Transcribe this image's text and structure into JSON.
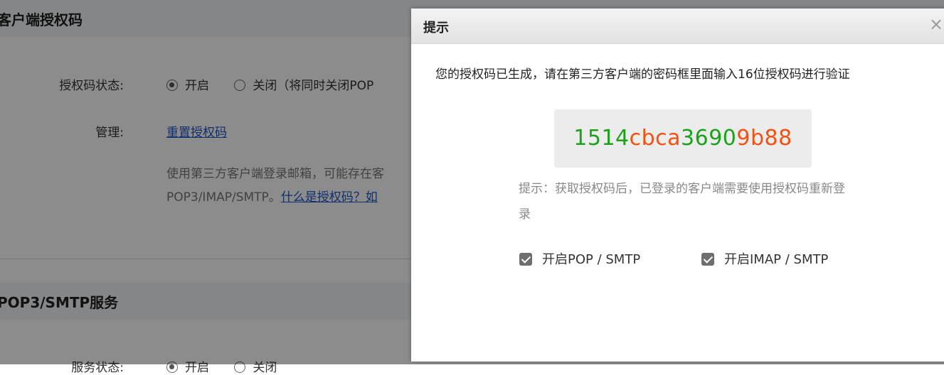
{
  "background": {
    "section1_title": "客户端授权码",
    "status_label": "授权码状态:",
    "status_options": {
      "on": "开启",
      "off": "关闭（将同时关闭POP"
    },
    "manage_label": "管理:",
    "reset_link": "重置授权码",
    "desc_line1": "使用第三方客户端登录邮箱，可能存在客",
    "desc_line2_prefix": "POP3/IMAP/SMTP。",
    "desc_line2_link": "什么是授权码？如",
    "section2_title": "POP3/SMTP服务",
    "service_status_label": "服务状态:",
    "service_options": {
      "on": "开启",
      "off": "关闭"
    }
  },
  "dialog": {
    "title": "提示",
    "close_symbol": "×",
    "message": "您的授权码已生成，请在第三方客户端的密码框里面输入16位授权码进行验证",
    "auth_code": {
      "segments": [
        {
          "text": "1514",
          "color": "green"
        },
        {
          "text": "cbca",
          "color": "orange"
        },
        {
          "text": "3690",
          "color": "green"
        },
        {
          "text": "9b88",
          "color": "orange"
        }
      ]
    },
    "hint": "提示：获取授权码后，已登录的客户端需要使用授权码重新登录",
    "options": {
      "pop_smtp": {
        "label": "开启POP / SMTP",
        "checked": true
      },
      "imap_smtp": {
        "label": "开启IMAP / SMTP",
        "checked": true
      }
    }
  },
  "colors": {
    "code_green": "#1aa21a",
    "code_orange": "#f4500f",
    "link": "#1a55c8"
  }
}
